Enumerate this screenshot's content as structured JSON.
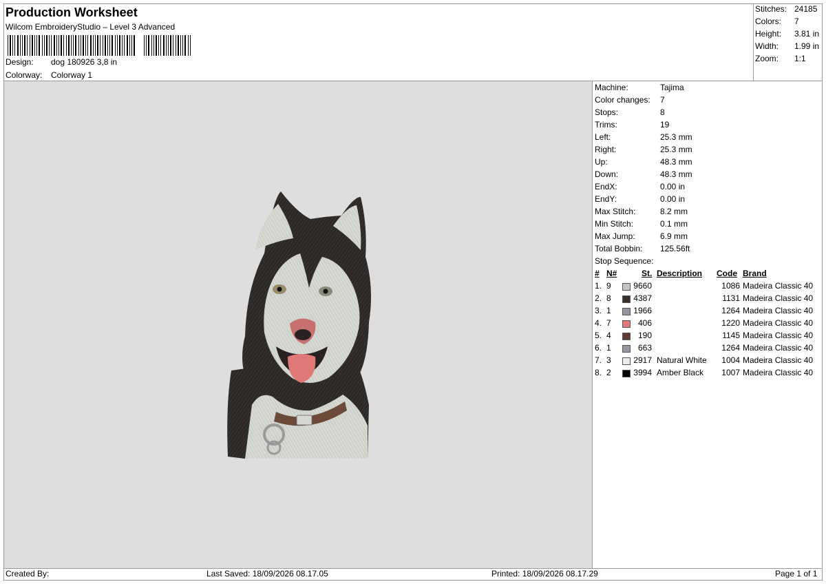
{
  "header": {
    "title": "Production Worksheet",
    "subtitle": "Wilcom EmbroideryStudio – Level 3 Advanced",
    "design_label": "Design:",
    "design_value": "dog 180926 3,8 in",
    "colorway_label": "Colorway:",
    "colorway_value": "Colorway 1"
  },
  "summary": [
    {
      "label": "Stitches:",
      "value": "24185"
    },
    {
      "label": "Colors:",
      "value": "7"
    },
    {
      "label": "Height:",
      "value": "3.81 in"
    },
    {
      "label": "Width:",
      "value": "1.99 in"
    },
    {
      "label": "Zoom:",
      "value": "1:1"
    }
  ],
  "details": [
    {
      "label": "Machine:",
      "value": "Tajima"
    },
    {
      "label": "Color changes:",
      "value": "7"
    },
    {
      "label": "Stops:",
      "value": "8"
    },
    {
      "label": "Trims:",
      "value": "19"
    },
    {
      "label": "Left:",
      "value": "25.3 mm"
    },
    {
      "label": "Right:",
      "value": "25.3 mm"
    },
    {
      "label": "Up:",
      "value": "48.3 mm"
    },
    {
      "label": "Down:",
      "value": "48.3 mm"
    },
    {
      "label": "EndX:",
      "value": "0.00 in"
    },
    {
      "label": "EndY:",
      "value": "0.00 in"
    },
    {
      "label": "Max Stitch:",
      "value": "8.2 mm"
    },
    {
      "label": "Min Stitch:",
      "value": "0.1 mm"
    },
    {
      "label": "Max Jump:",
      "value": "6.9 mm"
    },
    {
      "label": "Total Bobbin:",
      "value": "125.56ft"
    },
    {
      "label": "Stop Sequence:",
      "value": ""
    }
  ],
  "stop_table": {
    "headers": {
      "idx": "#",
      "n": "N#",
      "st": "St.",
      "desc": "Description",
      "code": "Code",
      "brand": "Brand"
    },
    "rows": [
      {
        "idx": "1.",
        "n": "9",
        "color": "#c6c6c6",
        "st": "9660",
        "desc": "",
        "code": "1086",
        "brand": "Madeira Classic 40"
      },
      {
        "idx": "2.",
        "n": "8",
        "color": "#3b302c",
        "st": "4387",
        "desc": "",
        "code": "1131",
        "brand": "Madeira Classic 40"
      },
      {
        "idx": "3.",
        "n": "1",
        "color": "#9a93a0",
        "st": "1966",
        "desc": "",
        "code": "1264",
        "brand": "Madeira Classic 40"
      },
      {
        "idx": "4.",
        "n": "7",
        "color": "#e07878",
        "st": "406",
        "desc": "",
        "code": "1220",
        "brand": "Madeira Classic 40"
      },
      {
        "idx": "5.",
        "n": "4",
        "color": "#5e3a30",
        "st": "190",
        "desc": "",
        "code": "1145",
        "brand": "Madeira Classic 40"
      },
      {
        "idx": "6.",
        "n": "1",
        "color": "#9a93a0",
        "st": "663",
        "desc": "",
        "code": "1264",
        "brand": "Madeira Classic 40"
      },
      {
        "idx": "7.",
        "n": "3",
        "color": "#ececec",
        "st": "2917",
        "desc": "Natural White",
        "code": "1004",
        "brand": "Madeira Classic 40"
      },
      {
        "idx": "8.",
        "n": "2",
        "color": "#050505",
        "st": "3994",
        "desc": "Amber Black",
        "code": "1007",
        "brand": "Madeira Classic 40"
      }
    ]
  },
  "footer": {
    "created_by": "Created By:",
    "last_saved": "Last Saved: 18/09/2026 08.17.05",
    "printed": "Printed: 18/09/2026 08.17.29",
    "page": "Page 1 of 1"
  },
  "preview": {
    "background": "#dedede",
    "design_subject": "husky-dog-embroidery"
  }
}
